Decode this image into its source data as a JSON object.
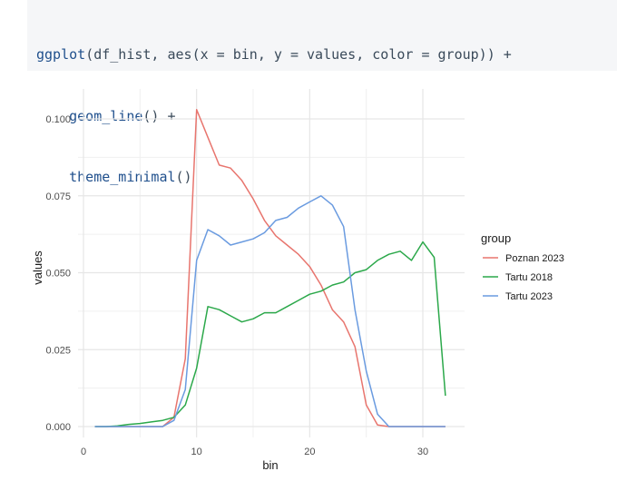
{
  "code": {
    "line1": {
      "fn": "ggplot",
      "rest": "(df_hist, aes(x = bin, y = values, color = group)) +"
    },
    "line2": {
      "fn": "geom_line",
      "rest": "() +"
    },
    "line3": {
      "fn": "theme_minimal",
      "rest": "()"
    }
  },
  "chart_data": {
    "type": "line",
    "xlabel": "bin",
    "ylabel": "values",
    "xlim": [
      0,
      32
    ],
    "ylim": [
      0,
      0.105
    ],
    "x_ticks": [
      0,
      10,
      20,
      30
    ],
    "x_tick_labels": [
      "0",
      "10",
      "20",
      "30"
    ],
    "y_ticks": [
      0,
      0.025,
      0.05,
      0.075,
      0.1
    ],
    "y_tick_labels": [
      "0.000",
      "0.025",
      "0.050",
      "0.075",
      "0.100"
    ],
    "grid": true,
    "legend": {
      "title": "group",
      "placement": "right"
    },
    "series": [
      {
        "name": "Poznan 2023",
        "color": "#E8756E",
        "x": [
          1,
          2,
          3,
          4,
          5,
          6,
          7,
          8,
          9,
          10,
          11,
          12,
          13,
          14,
          15,
          16,
          17,
          18,
          19,
          20,
          21,
          22,
          23,
          24,
          25,
          26,
          27,
          28,
          29,
          30,
          31,
          32
        ],
        "y": [
          0,
          0,
          0,
          0,
          0,
          0,
          0,
          0.003,
          0.022,
          0.103,
          0.094,
          0.085,
          0.084,
          0.08,
          0.074,
          0.067,
          0.062,
          0.059,
          0.056,
          0.052,
          0.046,
          0.038,
          0.034,
          0.026,
          0.007,
          0.0005,
          0,
          0,
          0,
          0,
          0,
          0
        ]
      },
      {
        "name": "Tartu 2018",
        "color": "#2BA84A",
        "x": [
          1,
          2,
          3,
          4,
          5,
          6,
          7,
          8,
          9,
          10,
          11,
          12,
          13,
          14,
          15,
          16,
          17,
          18,
          19,
          20,
          21,
          22,
          23,
          24,
          25,
          26,
          27,
          28,
          29,
          30,
          31,
          32
        ],
        "y": [
          0,
          0,
          0.0002,
          0.0007,
          0.001,
          0.0015,
          0.002,
          0.003,
          0.007,
          0.019,
          0.039,
          0.038,
          0.036,
          0.034,
          0.035,
          0.037,
          0.037,
          0.039,
          0.041,
          0.043,
          0.044,
          0.046,
          0.047,
          0.05,
          0.051,
          0.054,
          0.056,
          0.057,
          0.054,
          0.06,
          0.055,
          0.01
        ]
      },
      {
        "name": "Tartu 2023",
        "color": "#6A9BE0",
        "x": [
          1,
          2,
          3,
          4,
          5,
          6,
          7,
          8,
          9,
          10,
          11,
          12,
          13,
          14,
          15,
          16,
          17,
          18,
          19,
          20,
          21,
          22,
          23,
          24,
          25,
          26,
          27,
          28,
          29,
          30,
          31,
          32
        ],
        "y": [
          0,
          0,
          0,
          0,
          0,
          0,
          0,
          0.002,
          0.012,
          0.054,
          0.064,
          0.062,
          0.059,
          0.06,
          0.061,
          0.063,
          0.067,
          0.068,
          0.071,
          0.073,
          0.075,
          0.072,
          0.065,
          0.038,
          0.018,
          0.004,
          0,
          0,
          0,
          0,
          0,
          0
        ]
      }
    ]
  }
}
